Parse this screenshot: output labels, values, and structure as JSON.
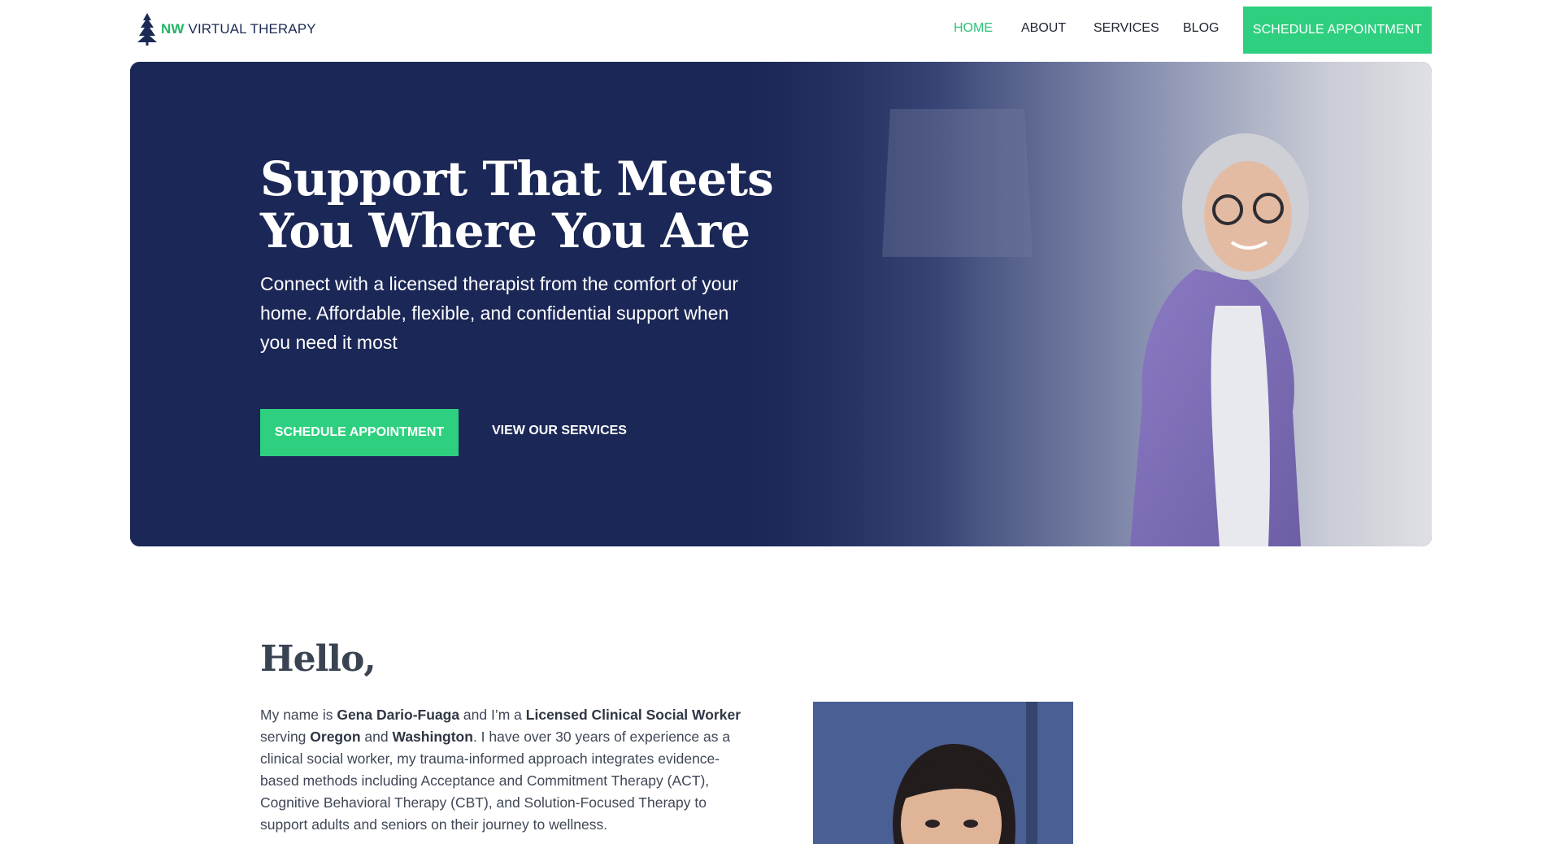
{
  "header": {
    "logo_nw": "NW",
    "logo_rest": "VIRTUAL THERAPY",
    "nav": [
      {
        "label": "HOME",
        "active": true
      },
      {
        "label": "ABOUT",
        "active": false
      },
      {
        "label": "SERVICES",
        "active": false
      },
      {
        "label": "BLOG",
        "active": false
      }
    ],
    "cta": "SCHEDULE APPOINTMENT"
  },
  "hero": {
    "title_line1": "Support That Meets",
    "title_line2": "You Where You Are",
    "subtitle": "Connect with a licensed therapist from the comfort of your home. Affordable, flexible, and confidential support when you need it most",
    "primary_button": "SCHEDULE APPOINTMENT",
    "secondary_link": "VIEW OUR SERVICES"
  },
  "hello": {
    "title": "Hello,",
    "p1": "My name is ",
    "name": "Gena Dario-Fuaga",
    "p2": " and I’m a ",
    "credential": "Licensed Clinical Social Worker",
    "p3": " serving ",
    "state1": "Oregon",
    "p4": " and ",
    "state2": "Washington",
    "p5": ". I have over 30 years of experience as a clinical social worker, my trauma-informed approach integrates evidence-based methods including Acceptance and Commitment Therapy (ACT), Cognitive Behavioral Therapy (CBT), and Solution-Focused Therapy to support adults and seniors on their journey to wellness."
  },
  "colors": {
    "brand_green": "#2ed07f",
    "navy": "#1b2756",
    "nav_active": "#2cc27a"
  }
}
